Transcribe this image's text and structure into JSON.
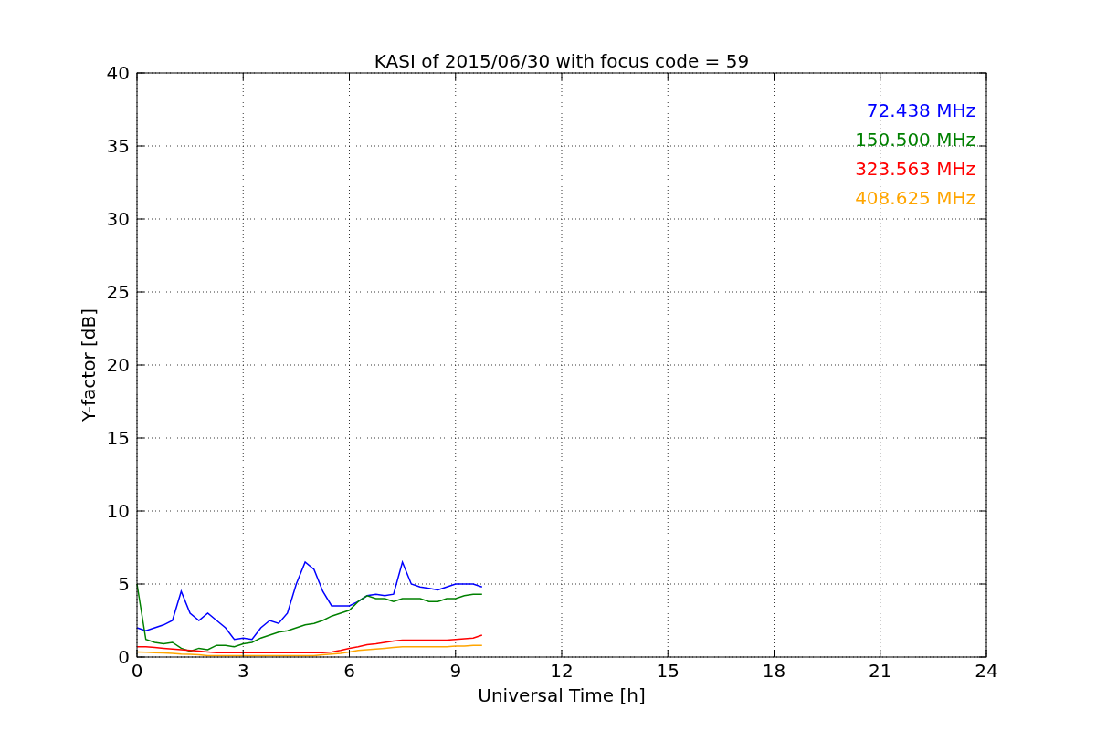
{
  "chart_data": {
    "type": "line",
    "title": "KASI of 2015/06/30 with focus code = 59",
    "xlabel": "Universal Time [h]",
    "ylabel": "Y-factor [dB]",
    "x": [
      0,
      0.25,
      0.5,
      0.75,
      1,
      1.25,
      1.5,
      1.75,
      2,
      2.25,
      2.5,
      2.75,
      3,
      3.25,
      3.5,
      3.75,
      4,
      4.25,
      4.5,
      4.75,
      5,
      5.25,
      5.5,
      5.75,
      6,
      6.25,
      6.5,
      6.75,
      7,
      7.25,
      7.5,
      7.75,
      8,
      8.25,
      8.5,
      8.75,
      9,
      9.25,
      9.5,
      9.75
    ],
    "series": [
      {
        "name": "72.438 MHz",
        "color": "#0000ff",
        "values": [
          2,
          1.8,
          2,
          2.2,
          2.5,
          4.5,
          3,
          2.5,
          3,
          2.5,
          2,
          1.2,
          1.3,
          1.2,
          2,
          2.5,
          2.3,
          3,
          5,
          6.5,
          6,
          4.5,
          3.5,
          3.5,
          3.5,
          3.8,
          4.2,
          4.3,
          4.2,
          4.3,
          6.5,
          5,
          4.8,
          4.7,
          4.6,
          4.8,
          5,
          5,
          5,
          4.8
        ]
      },
      {
        "name": "150.500 MHz",
        "color": "#008000",
        "values": [
          5,
          1.2,
          1,
          0.9,
          1,
          0.6,
          0.4,
          0.6,
          0.5,
          0.8,
          0.8,
          0.7,
          0.9,
          1,
          1.3,
          1.5,
          1.7,
          1.8,
          2,
          2.2,
          2.3,
          2.5,
          2.8,
          3,
          3.2,
          3.8,
          4.2,
          4,
          4,
          3.8,
          4,
          4,
          4,
          3.8,
          3.8,
          4,
          4,
          4.2,
          4.3,
          4.3
        ]
      },
      {
        "name": "323.563 MHz",
        "color": "#ff0000",
        "values": [
          0.7,
          0.7,
          0.65,
          0.6,
          0.55,
          0.5,
          0.45,
          0.4,
          0.35,
          0.3,
          0.3,
          0.3,
          0.3,
          0.3,
          0.3,
          0.3,
          0.3,
          0.3,
          0.3,
          0.3,
          0.3,
          0.3,
          0.35,
          0.45,
          0.6,
          0.7,
          0.85,
          0.9,
          1,
          1.1,
          1.15,
          1.15,
          1.15,
          1.15,
          1.15,
          1.15,
          1.2,
          1.25,
          1.3,
          1.5
        ]
      },
      {
        "name": "408.625 MHz",
        "color": "#ffa500",
        "values": [
          0.35,
          0.33,
          0.3,
          0.28,
          0.25,
          0.2,
          0.18,
          0.15,
          0.1,
          0.1,
          0.1,
          0.1,
          0.1,
          0.1,
          0.1,
          0.1,
          0.1,
          0.1,
          0.1,
          0.1,
          0.1,
          0.15,
          0.2,
          0.25,
          0.35,
          0.45,
          0.5,
          0.55,
          0.6,
          0.65,
          0.7,
          0.7,
          0.7,
          0.7,
          0.7,
          0.7,
          0.75,
          0.75,
          0.8,
          0.8
        ]
      }
    ],
    "grid": true,
    "xlim": [
      0,
      24
    ],
    "ylim": [
      0,
      40
    ],
    "xticks": [
      0,
      3,
      6,
      9,
      12,
      15,
      18,
      21,
      24
    ],
    "yticks": [
      0,
      5,
      10,
      15,
      20,
      25,
      30,
      35,
      40
    ]
  }
}
